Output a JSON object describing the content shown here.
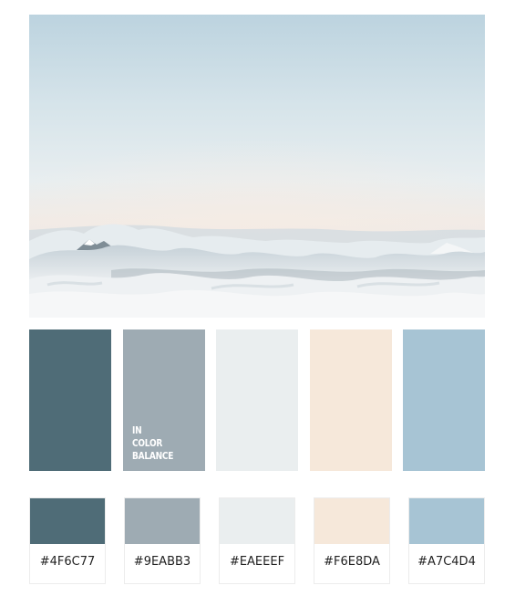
{
  "colors": {
    "c1": "#4F6C77",
    "c2": "#9EABB3",
    "c3": "#EAEEEF",
    "c4": "#F6E8DA",
    "c5": "#A7C4D4"
  },
  "brand": {
    "line1": "IN",
    "line2": "COLOR",
    "line3": "BALANCE"
  },
  "palette": [
    {
      "hex": "#4F6C77"
    },
    {
      "hex": "#9EABB3"
    },
    {
      "hex": "#EAEEEF"
    },
    {
      "hex": "#F6E8DA"
    },
    {
      "hex": "#A7C4D4"
    }
  ]
}
